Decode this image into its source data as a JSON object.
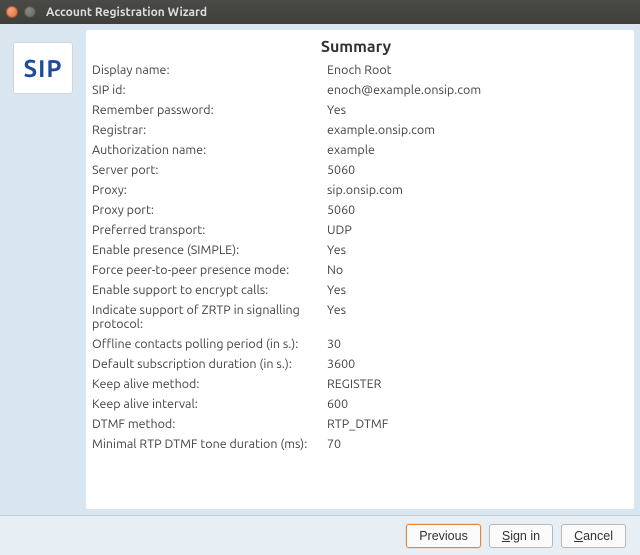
{
  "window": {
    "title": "Account Registration Wizard"
  },
  "sidebar": {
    "logo_text": "SIP"
  },
  "main": {
    "heading": "Summary",
    "rows": [
      {
        "label": "Display name:",
        "value": "Enoch Root"
      },
      {
        "label": "SIP id:",
        "value": "enoch@example.onsip.com"
      },
      {
        "label": "Remember password:",
        "value": "Yes"
      },
      {
        "label": "Registrar:",
        "value": "example.onsip.com"
      },
      {
        "label": "Authorization name:",
        "value": "example"
      },
      {
        "label": "Server port:",
        "value": "5060"
      },
      {
        "label": "Proxy:",
        "value": "sip.onsip.com"
      },
      {
        "label": "Proxy port:",
        "value": "5060"
      },
      {
        "label": "Preferred transport:",
        "value": "UDP"
      },
      {
        "label": "Enable presence (SIMPLE):",
        "value": "Yes"
      },
      {
        "label": "Force peer-to-peer presence mode:",
        "value": "No"
      },
      {
        "label": "Enable support to encrypt calls:",
        "value": "Yes"
      },
      {
        "label": "Indicate support of ZRTP in signalling protocol:",
        "value": "Yes"
      },
      {
        "label": "Offline contacts polling period (in s.):",
        "value": "30"
      },
      {
        "label": "Default subscription duration (in s.):",
        "value": "3600"
      },
      {
        "label": "Keep alive method:",
        "value": "REGISTER"
      },
      {
        "label": "Keep alive interval:",
        "value": "600"
      },
      {
        "label": "DTMF method:",
        "value": "RTP_DTMF"
      },
      {
        "label": "Minimal RTP DTMF tone duration (ms):",
        "value": "70"
      }
    ]
  },
  "buttons": {
    "previous": "Previous",
    "sign_in_pre": "S",
    "sign_in_post": "ign in",
    "cancel_pre": "C",
    "cancel_post": "ancel"
  }
}
